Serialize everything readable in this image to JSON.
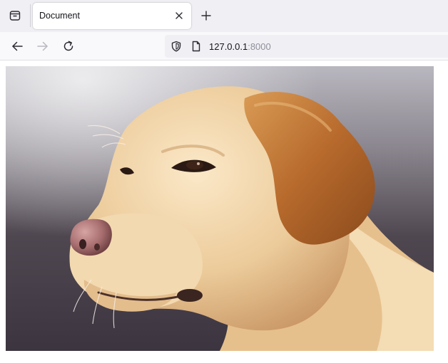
{
  "tabs": [
    {
      "title": "Document",
      "active": true
    }
  ],
  "address_bar": {
    "host": "127.0.0.1",
    "port": ":8000"
  },
  "icons": {
    "tab_overview": "tab-overview-icon",
    "close": "close-icon",
    "new_tab": "plus-icon",
    "back": "arrow-left-icon",
    "forward": "arrow-right-icon",
    "reload": "reload-icon",
    "shield": "shield-icon",
    "page": "page-icon"
  },
  "colors": {
    "tab_strip": "#f0f0f4",
    "nav_bar": "#f9f9fb",
    "url_field": "#f0f0f4",
    "port_text": "#8f8f9d"
  },
  "page": {
    "image_subject": "yellow labrador retriever"
  }
}
